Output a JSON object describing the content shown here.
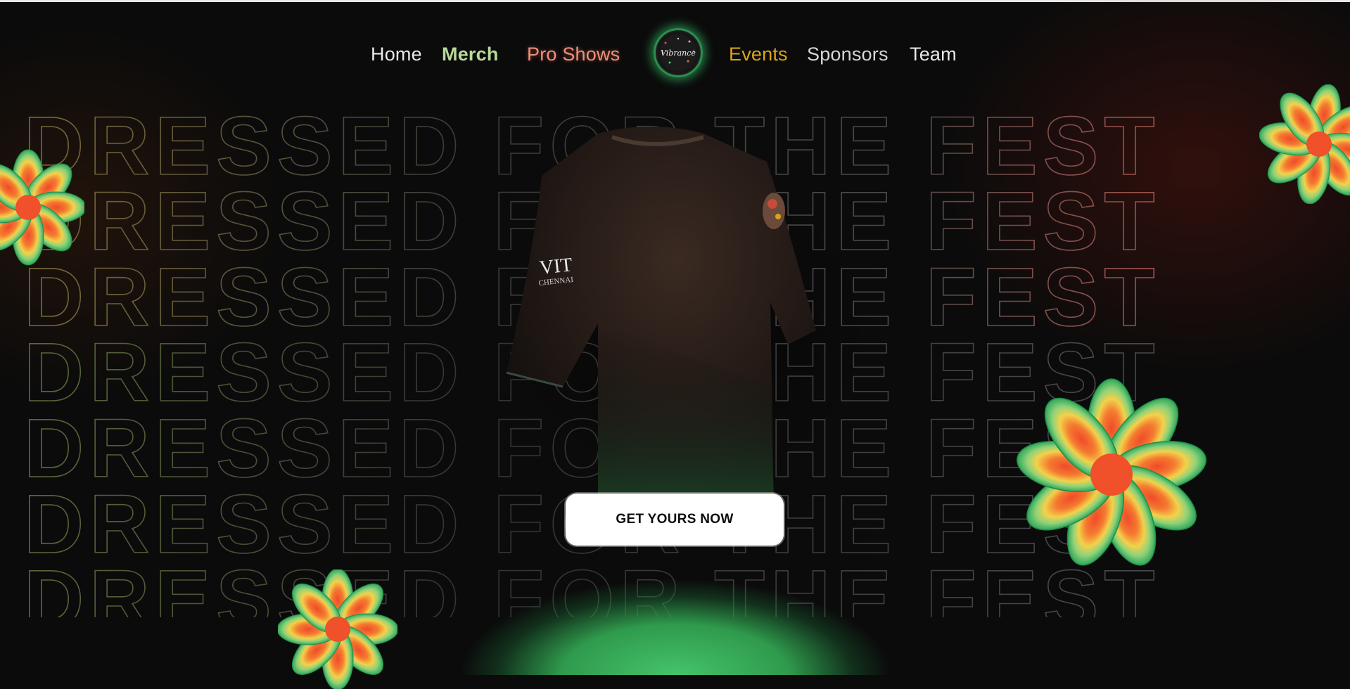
{
  "nav": {
    "home": "Home",
    "merch": "Merch",
    "pro_shows": "Pro Shows",
    "events": "Events",
    "sponsors": "Sponsors",
    "team": "Team",
    "logo_text": "Vibrance"
  },
  "hero": {
    "headline": "DRESSED FOR THE FEST",
    "shirt_sleeve_text_1": "VIT",
    "shirt_sleeve_text_2": "CHENNAI"
  },
  "cta": {
    "label": "GET YOURS NOW"
  },
  "colors": {
    "background": "#0b0b0b",
    "accent_green": "#45c46a",
    "merch_green": "#b9d99a",
    "pro_shows_red": "#ef8f7a",
    "events_gold": "#d9a514"
  }
}
